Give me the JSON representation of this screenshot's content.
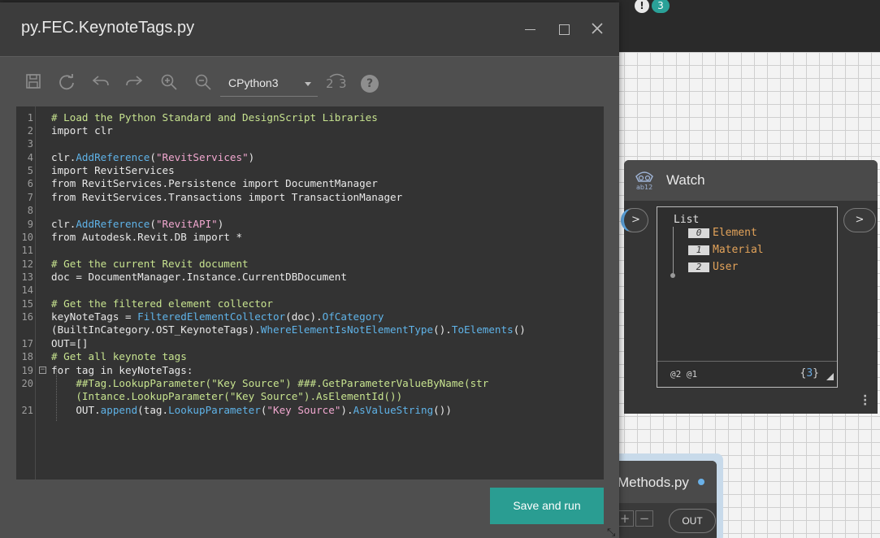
{
  "canvas": {
    "alert_icon": "!",
    "alert_count": "3",
    "watch_node": {
      "icon_label": "ab12",
      "title": "Watch",
      "in_port": ">",
      "out_port": ">",
      "list_label": "List",
      "items": [
        {
          "index": "0",
          "value": "Element"
        },
        {
          "index": "1",
          "value": "Material"
        },
        {
          "index": "2",
          "value": "User"
        }
      ],
      "levels": "@2 @1",
      "count_open": "{",
      "count": "3",
      "count_close": "}"
    },
    "second_node": {
      "title": "Methods.py",
      "add_label": "+",
      "remove_label": "−",
      "out_port": "OUT"
    }
  },
  "dialog": {
    "title": "py.FEC.KeynoteTags.py",
    "toolbar": {
      "icons": [
        "save-icon",
        "refresh-icon",
        "undo-icon",
        "redo-icon",
        "zoom-in-icon",
        "zoom-out-icon",
        "migrate-icon",
        "help-icon"
      ],
      "engine": "CPython3",
      "help": "?"
    },
    "save_run_label": "Save and run",
    "line_numbers": [
      "1",
      "2",
      "3",
      "4",
      "5",
      "6",
      "7",
      "8",
      "9",
      "10",
      "11",
      "12",
      "13",
      "14",
      "15",
      "16",
      "17",
      "18",
      "19",
      "20",
      "21"
    ],
    "code": {
      "l1": "# Load the Python Standard and DesignScript Libraries",
      "l2a": "import",
      "l2b": " clr",
      "l4a": "clr.",
      "l4b": "AddReference",
      "l4c": "(",
      "l4d": "\"RevitServices\"",
      "l4e": ")",
      "l5a": "import",
      "l5b": " RevitServices",
      "l6a": "from",
      "l6b": " RevitServices.Persistence ",
      "l6c": "import",
      "l6d": " DocumentManager",
      "l7a": "from",
      "l7b": " RevitServices.Transactions ",
      "l7c": "import",
      "l7d": " TransactionManager",
      "l9a": "clr.",
      "l9b": "AddReference",
      "l9c": "(",
      "l9d": "\"RevitAPI\"",
      "l9e": ")",
      "l10a": "from",
      "l10b": " Autodesk.Revit.DB ",
      "l10c": "import",
      "l10d": " *",
      "l12": "# Get the current Revit document",
      "l13": "doc = DocumentManager.Instance.CurrentDBDocument",
      "l15": "# Get the filtered element collector",
      "l16a": "keyNoteTags = ",
      "l16b": "FilteredElementCollector",
      "l16c": "(doc).",
      "l16d": "OfCategory",
      "l16e": "(BuiltInCategory.OST_KeynoteTags).",
      "l16f": "WhereElementIsNotElementType",
      "l16g": "().",
      "l16h": "ToElements",
      "l16i": "()",
      "l17": "OUT=[]",
      "l18": "# Get all keynote tags",
      "l19a": "for",
      "l19b": " tag ",
      "l19c": "in",
      "l19d": " keyNoteTags:",
      "l20a": "    ##Tag.LookupParameter(\"Key Source\") ###.GetParameterValueByName(str",
      "l20b": "    (Intance.LookupParameter(\"Key Source\").AsElementId())",
      "l21a": "    OUT.",
      "l21b": "append",
      "l21c": "(tag.",
      "l21d": "LookupParameter",
      "l21e": "(",
      "l21f": "\"Key Source\"",
      "l21g": ").",
      "l21h": "AsValueString",
      "l21i": "())"
    }
  }
}
